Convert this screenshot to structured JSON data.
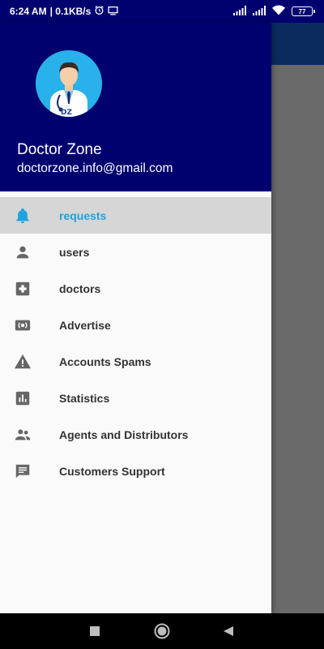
{
  "status_bar": {
    "time": "6:24 AM",
    "speed": "| 0.1KB/s",
    "battery": "77"
  },
  "profile": {
    "name": "Doctor Zone",
    "email": "doctorzone.info@gmail.com",
    "avatar_text": "DZ"
  },
  "menu": {
    "items": [
      {
        "label": "requests",
        "icon": "bell-icon"
      },
      {
        "label": "users",
        "icon": "person-icon"
      },
      {
        "label": "doctors",
        "icon": "medical-plus-icon"
      },
      {
        "label": "Advertise",
        "icon": "broadcast-icon"
      },
      {
        "label": "Accounts Spams",
        "icon": "warning-icon"
      },
      {
        "label": "Statistics",
        "icon": "bar-chart-icon"
      },
      {
        "label": "Agents and Distributors",
        "icon": "people-icon"
      },
      {
        "label": "Customers Support",
        "icon": "chat-icon"
      }
    ],
    "selected_index": 0
  },
  "colors": {
    "header": "#00006f",
    "selected_text": "#1ea3e0",
    "icon": "#666666"
  }
}
